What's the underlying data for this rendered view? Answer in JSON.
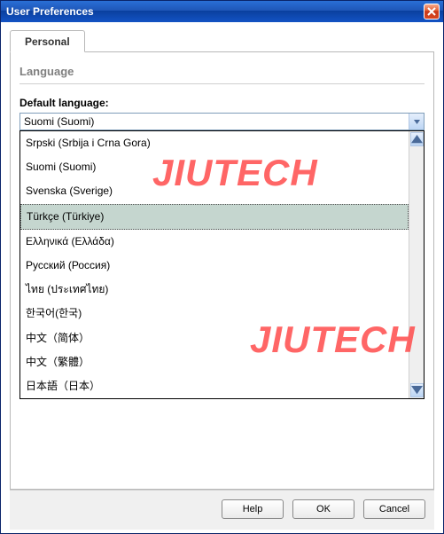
{
  "window": {
    "title": "User Preferences"
  },
  "tabs": [
    {
      "label": "Personal"
    }
  ],
  "section": {
    "heading": "Language"
  },
  "field": {
    "label": "Default language:",
    "selected": "Suomi (Suomi)"
  },
  "options": [
    {
      "label": "Srpski (Srbija i Crna Gora)"
    },
    {
      "label": "Suomi (Suomi)"
    },
    {
      "label": "Svenska (Sverige)"
    },
    {
      "label": "Türkçe (Türkiye)",
      "highlight": true
    },
    {
      "label": "Ελληνικά (Ελλάδα)"
    },
    {
      "label": "Русский (Россия)"
    },
    {
      "label": "ไทย (ประเทศไทย)"
    },
    {
      "label": "한국어(한국)"
    },
    {
      "label": "中文（简体）"
    },
    {
      "label": "中文（繁體）"
    },
    {
      "label": "日本語（日本）"
    }
  ],
  "footer": {
    "help": "Help",
    "ok": "OK",
    "cancel": "Cancel"
  },
  "watermark": {
    "text": "JIUTECH"
  }
}
